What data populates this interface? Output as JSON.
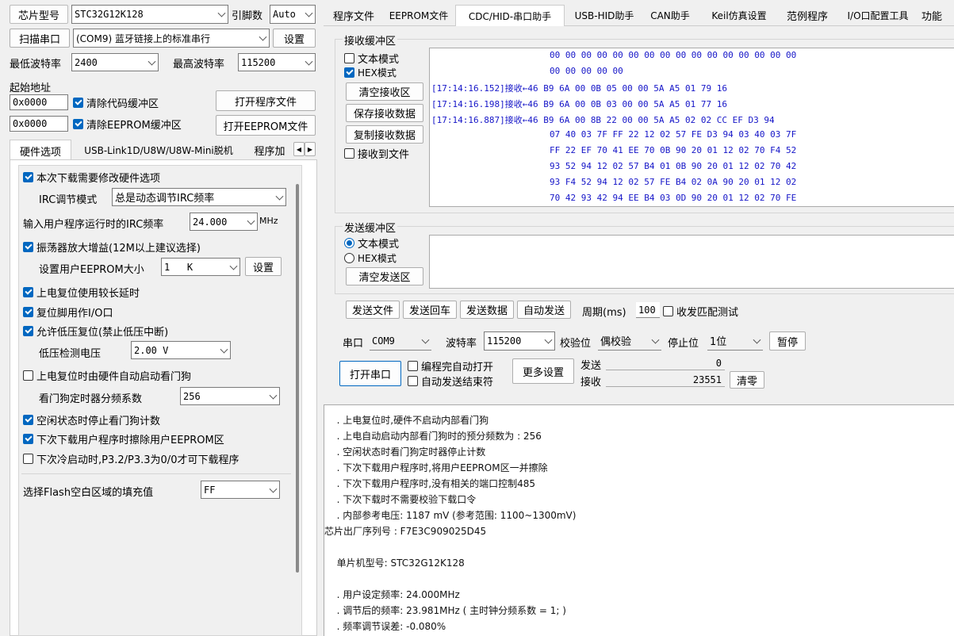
{
  "top_left": {
    "chip_label": "芯片型号",
    "chip_value": "STC32G12K128",
    "pin_label": "引脚数",
    "pin_value": "Auto",
    "scan_button": "扫描串口",
    "port_value": "(COM9) 蓝牙链接上的标准串行",
    "settings_button": "设置",
    "min_baud_label": "最低波特率",
    "min_baud_value": "2400",
    "max_baud_label": "最高波特率",
    "max_baud_value": "115200",
    "start_addr_label": "起始地址",
    "code_addr": "0x0000",
    "clear_code_label": "清除代码缓冲区",
    "open_prog_button": "打开程序文件",
    "eeprom_addr": "0x0000",
    "clear_eeprom_label": "清除EEPROM缓冲区",
    "open_eeprom_button": "打开EEPROM文件"
  },
  "left_tabs": [
    "硬件选项",
    "USB-Link1D/U8W/U8W-Mini脱机",
    "程序加"
  ],
  "hw": {
    "opt1": "本次下载需要修改硬件选项",
    "irc_mode_label": "IRC调节模式",
    "irc_mode_value": "总是动态调节IRC频率",
    "irc_freq_label": "输入用户程序运行时的IRC频率",
    "irc_freq_value": "24.000",
    "irc_freq_unit": "MHz",
    "opt_osc": "振荡器放大增益(12M以上建议选择)",
    "eeprom_size_label": "设置用户EEPROM大小",
    "eeprom_size_value": "1   K",
    "eeprom_set_button": "设置",
    "opt_long_delay": "上电复位使用较长延时",
    "opt_reset_pin": "复位脚用作I/O口",
    "opt_lvr": "允许低压复位(禁止低压中断)",
    "lvd_label": "低压检测电压",
    "lvd_value": "2.00 V",
    "opt_wdt": "上电复位时由硬件自动启动看门狗",
    "wdt_div_label": "看门狗定时器分频系数",
    "wdt_div_value": "256",
    "opt_idle_wdt": "空闲状态时停止看门狗计数",
    "opt_erase_eeprom": "下次下载用户程序时擦除用户EEPROM区",
    "opt_cold_boot": "下次冷启动时,P3.2/P3.3为0/0才可下载程序",
    "fill_label": "选择Flash空白区域的填充值",
    "fill_value": "FF"
  },
  "main_tabs": [
    "程序文件",
    "EEPROM文件",
    "CDC/HID-串口助手",
    "USB-HID助手",
    "CAN助手",
    "Keil仿真设置",
    "范例程序",
    "I/O口配置工具",
    "功能"
  ],
  "recv": {
    "title": "接收缓冲区",
    "text_mode": "文本模式",
    "hex_mode": "HEX模式",
    "clear_button": "清空接收区",
    "save_button": "保存接收数据",
    "copy_button": "复制接收数据",
    "to_file": "接收到文件",
    "lines": [
      {
        "prefix": "",
        "hex": "00 00 00 00 00 00 00 00 00 00 00 00 00 00 00 00"
      },
      {
        "prefix": "",
        "hex": "00 00 00 00 00"
      },
      {
        "prefix": "[17:14:16.152]接收←",
        "hex": "46 B9 6A 00 0B 05 00 00 5A A5 01 79 16"
      },
      {
        "prefix": "[17:14:16.198]接收←",
        "hex": "46 B9 6A 00 0B 03 00 00 5A A5 01 77 16"
      },
      {
        "prefix": "[17:14:16.887]接收←",
        "hex": "46 B9 6A 00 8B 22 00 00 5A A5 02 02 CC EF D3 94"
      },
      {
        "prefix": "",
        "hex": "07 40 03 7F FF 22 12 02 57 FE D3 94 03 40 03 7F"
      },
      {
        "prefix": "",
        "hex": "FF 22 EF 70 41 EE 70 0B 90 20 01 12 02 70 F4 52"
      },
      {
        "prefix": "",
        "hex": "93 52 94 12 02 57 B4 01 0B 90 20 01 12 02 70 42"
      },
      {
        "prefix": "",
        "hex": "93 F4 52 94 12 02 57 FE B4 02 0A 90 20 01 12 02"
      },
      {
        "prefix": "",
        "hex": "70 42 93 42 94 EE B4 03 0D 90 20 01 12 02 70 FE"
      }
    ]
  },
  "send": {
    "title": "发送缓冲区",
    "text_mode": "文本模式",
    "hex_mode": "HEX模式",
    "clear_button": "清空发送区",
    "send_file": "发送文件",
    "send_cr": "发送回车",
    "send_data": "发送数据",
    "auto_send": "自动发送",
    "period_label": "周期(ms)",
    "period_value": "100",
    "match_test": "收发匹配测试"
  },
  "port": {
    "port_label": "串口",
    "port_value": "COM9",
    "baud_label": "波特率",
    "baud_value": "115200",
    "parity_label": "校验位",
    "parity_value": "偶校验",
    "stop_label": "停止位",
    "stop_value": "1位",
    "pause_button": "暂停",
    "open_button": "打开串口",
    "auto_open": "编程完自动打开",
    "auto_end": "自动发送结束符",
    "more_button": "更多设置",
    "sent_label": "发送",
    "sent_value": "0",
    "recv_label": "接收",
    "recv_value": "23551",
    "reset_button": "清零"
  },
  "log": [
    "  . 上电复位时,硬件不启动内部看门狗",
    "  . 上电自动启动内部看门狗时的预分频数为 : 256",
    "  . 空闲状态时看门狗定时器停止计数",
    "  . 下次下载用户程序时,将用户EEPROM区一并擦除",
    "  . 下次下载用户程序时,没有相关的端口控制485",
    "  . 下次下载时不需要校验下载口令",
    "  . 内部参考电压: 1187 mV (参考范围: 1100~1300mV)",
    "芯片出厂序列号 : F7E3C909025D45",
    "",
    "  单片机型号: STC32G12K128",
    "",
    "  . 用户设定频率: 24.000MHz",
    "  . 调节后的频率: 23.981MHz ( 主时钟分频系数 = 1; )",
    "  . 频率调节误差: -0.080%"
  ]
}
